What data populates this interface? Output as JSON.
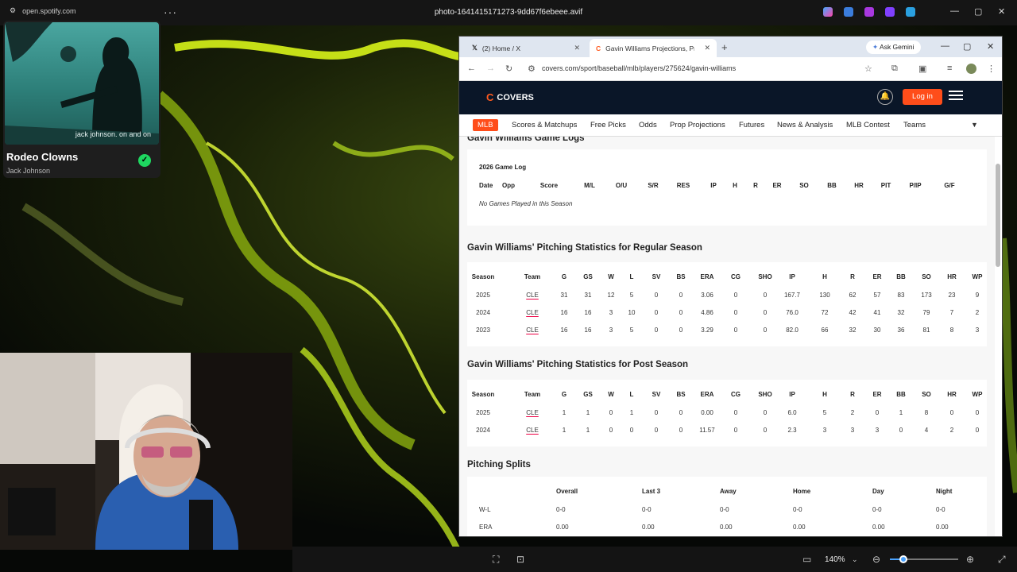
{
  "topbar": {
    "spotify_url": "open.spotify.com",
    "window_title": "photo-1641415171273-9dd67f6ebeee.avif"
  },
  "spotify": {
    "art_caption": "jack johnson. on and on",
    "song": "Rodeo Clowns",
    "artist": "Jack Johnson"
  },
  "browser": {
    "tabs": [
      {
        "label": "(2) Home / X"
      },
      {
        "label": "Gavin Williams Projections, Pro"
      }
    ],
    "ask_gemini": "Ask Gemini",
    "url": "covers.com/sport/baseball/mlb/players/275624/gavin-williams"
  },
  "site": {
    "logo": "COVERS",
    "login": "Log in",
    "nav": [
      "MLB",
      "Scores & Matchups",
      "Free Picks",
      "Odds",
      "Prop Projections",
      "Futures",
      "News & Analysis",
      "MLB Contest",
      "Teams"
    ]
  },
  "game_logs": {
    "title": "Gavin Williams Game Logs",
    "subtitle": "2026 Game Log",
    "columns": [
      "Date",
      "Opp",
      "Score",
      "M/L",
      "O/U",
      "S/R",
      "RES",
      "IP",
      "H",
      "R",
      "ER",
      "SO",
      "BB",
      "HR",
      "PIT",
      "P/IP",
      "G/F"
    ],
    "empty": "No Games Played in this Season"
  },
  "regular": {
    "title": "Gavin Williams' Pitching Statistics for Regular Season",
    "columns": [
      "Season",
      "Team",
      "G",
      "GS",
      "W",
      "L",
      "SV",
      "BS",
      "ERA",
      "CG",
      "SHO",
      "IP",
      "H",
      "R",
      "ER",
      "BB",
      "SO",
      "HR",
      "WP"
    ],
    "rows": [
      [
        "2025",
        "CLE",
        "31",
        "31",
        "12",
        "5",
        "0",
        "0",
        "3.06",
        "0",
        "0",
        "167.7",
        "130",
        "62",
        "57",
        "83",
        "173",
        "23",
        "9"
      ],
      [
        "2024",
        "CLE",
        "16",
        "16",
        "3",
        "10",
        "0",
        "0",
        "4.86",
        "0",
        "0",
        "76.0",
        "72",
        "42",
        "41",
        "32",
        "79",
        "7",
        "2"
      ],
      [
        "2023",
        "CLE",
        "16",
        "16",
        "3",
        "5",
        "0",
        "0",
        "3.29",
        "0",
        "0",
        "82.0",
        "66",
        "32",
        "30",
        "36",
        "81",
        "8",
        "3"
      ]
    ]
  },
  "post": {
    "title": "Gavin Williams' Pitching Statistics for Post Season",
    "columns": [
      "Season",
      "Team",
      "G",
      "GS",
      "W",
      "L",
      "SV",
      "BS",
      "ERA",
      "CG",
      "SHO",
      "IP",
      "H",
      "R",
      "ER",
      "BB",
      "SO",
      "HR",
      "WP"
    ],
    "rows": [
      [
        "2025",
        "CLE",
        "1",
        "1",
        "0",
        "1",
        "0",
        "0",
        "0.00",
        "0",
        "0",
        "6.0",
        "5",
        "2",
        "0",
        "1",
        "8",
        "0",
        "0"
      ],
      [
        "2024",
        "CLE",
        "1",
        "1",
        "0",
        "0",
        "0",
        "0",
        "11.57",
        "0",
        "0",
        "2.3",
        "3",
        "3",
        "3",
        "0",
        "4",
        "2",
        "0"
      ]
    ]
  },
  "splits": {
    "title": "Pitching Splits",
    "columns": [
      "",
      "Overall",
      "Last 3",
      "Away",
      "Home",
      "Day",
      "Night"
    ],
    "rows": [
      [
        "W-L",
        "0-0",
        "0-0",
        "0-0",
        "0-0",
        "0-0",
        "0-0"
      ],
      [
        "ERA",
        "0.00",
        "0.00",
        "0.00",
        "0.00",
        "0.00",
        "0.00"
      ]
    ]
  },
  "viewer": {
    "zoom": "140%",
    "zoom_fraction": 0.2
  }
}
